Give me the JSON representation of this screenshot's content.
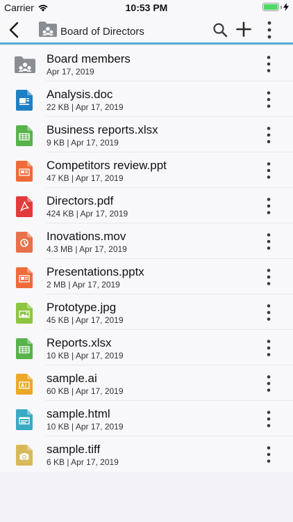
{
  "status_bar": {
    "carrier": "Carrier",
    "time": "10:53 PM"
  },
  "navbar": {
    "title": "Board of Directors",
    "accent_color": "#5aa9d6"
  },
  "files": [
    {
      "name": "Board members",
      "meta": "Apr 17, 2019",
      "type": "folder",
      "color": "#8a8d92"
    },
    {
      "name": "Analysis.doc",
      "meta": "22 KB | Apr 17, 2019",
      "type": "doc",
      "color": "#1f7fc4"
    },
    {
      "name": "Business reports.xlsx",
      "meta": "9 KB | Apr 17, 2019",
      "type": "xls",
      "color": "#57b34a"
    },
    {
      "name": "Competitors review.ppt",
      "meta": "47 KB | Apr 17, 2019",
      "type": "ppt",
      "color": "#ef6b3a"
    },
    {
      "name": "Directors.pdf",
      "meta": "424 KB | Apr 17, 2019",
      "type": "pdf",
      "color": "#e23b3b"
    },
    {
      "name": "Inovations.mov",
      "meta": "4.3 MB | Apr 17, 2019",
      "type": "mov",
      "color": "#e8704a"
    },
    {
      "name": "Presentations.pptx",
      "meta": "2 MB | Apr 17, 2019",
      "type": "ppt",
      "color": "#ef6b3a"
    },
    {
      "name": "Prototype.jpg",
      "meta": "45 KB | Apr 17, 2019",
      "type": "img",
      "color": "#8cc63f"
    },
    {
      "name": "Reports.xlsx",
      "meta": "10 KB | Apr 17, 2019",
      "type": "xls",
      "color": "#57b34a"
    },
    {
      "name": "sample.ai",
      "meta": "60 KB | Apr 17, 2019",
      "type": "ai",
      "color": "#eba82b"
    },
    {
      "name": "sample.html",
      "meta": "10 KB | Apr 17, 2019",
      "type": "html",
      "color": "#3aa9c4"
    },
    {
      "name": "sample.tiff",
      "meta": "6 KB | Apr 17, 2019",
      "type": "tiff",
      "color": "#d8b95a"
    }
  ]
}
